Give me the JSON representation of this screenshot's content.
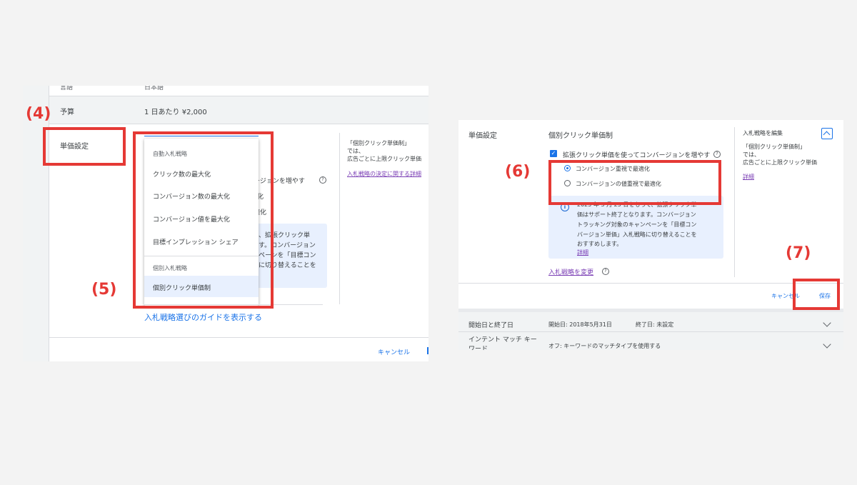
{
  "steps": {
    "s4": "(4)",
    "s5": "(5)",
    "s6": "(6)",
    "s7": "(7)"
  },
  "left": {
    "lang_label": "言語",
    "lang_value": "日本語",
    "budget_label": "予算",
    "budget_value": "1 日あたり ¥2,000",
    "bid_label": "単価設定",
    "dropdown": {
      "auto_header": "自動入札戦略",
      "auto_items": [
        "クリック数の最大化",
        "コンバージョン数の最大化",
        "コンバージョン値を最大化",
        "目標インプレッション シェア"
      ],
      "manual_header": "個別入札戦略",
      "manual_item": "個別クリック単価制"
    },
    "behind_checkbox_text": "バージョンを増やす",
    "behind_line2": "化",
    "behind_line3": "最適化",
    "behind_info": [
      "、拡張クリック単",
      "す。コンバージョン",
      "ペーンを「目標コン",
      "に切り替えることを"
    ],
    "side_note_title": "「個別クリック単価制」",
    "side_note_line2": "では、",
    "side_note_line3": "広告ごとに上限クリック単価",
    "side_note_link": "入札戦略の決定に関する詳細",
    "guide_link": "入札戦略選びのガイドを表示する",
    "cancel": "キャンセル"
  },
  "right": {
    "bid_label": "単価設定",
    "bid_value": "個別クリック単価制",
    "checkbox_label": "拡張クリック単価を使ってコンバージョンを増やす",
    "radio1": "コンバージョン重視で最適化",
    "radio2": "コンバージョンの値重視で最適化",
    "info_lines": [
      "2025 年 3 月 25 日をもって、拡張クリック単",
      "価はサポート終了となります。コンバージョン",
      "トラッキング対象のキャンペーンを「目標コン",
      "バージョン単価」入札戦略に切り替えることを",
      "おすすめします。"
    ],
    "info_link": "詳細",
    "change_strategy": "入札戦略を変更",
    "side_title": "入札戦略を編集",
    "side_line1": "「個別クリック単価制」",
    "side_line2": "では、",
    "side_line3": "広告ごとに上限クリック単価",
    "side_link": "詳細",
    "cancel": "キャンセル",
    "save": "保存",
    "start_end_label": "開始日と終了日",
    "start_value": "開始日: 2018年5月31日",
    "end_value": "終了日: 未設定",
    "intent_label": "インテント マッチ キーワード",
    "intent_value": "オフ: キーワードのマッチタイプを使用する"
  },
  "colors": {
    "accent": "#1a73e8",
    "highlight": "#e53935",
    "info_bg": "#e8f0fe"
  }
}
